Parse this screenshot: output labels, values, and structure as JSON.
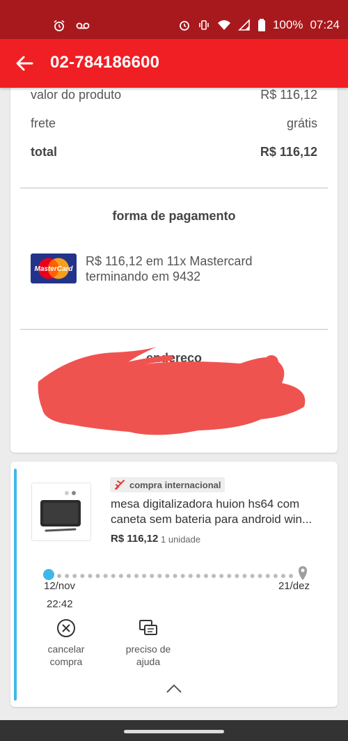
{
  "status_bar": {
    "battery": "100%",
    "time": "07:24"
  },
  "app_bar": {
    "title": "02-784186600"
  },
  "summary": {
    "product_value_label": "valor do produto",
    "product_value": "R$ 116,12",
    "shipping_label": "frete",
    "shipping_value": "grátis",
    "total_label": "total",
    "total_value": "R$ 116,12"
  },
  "payment": {
    "title": "forma de pagamento",
    "card_brand": "MasterCard",
    "line1": "R$ 116,12 em 11x Mastercard",
    "line2": "terminando em 9432"
  },
  "address": {
    "title": "endereço"
  },
  "order": {
    "badge": "compra internacional",
    "product_line1": "mesa digitalizadora huion hs64 com",
    "product_line2": "caneta sem bateria para android win...",
    "price": "R$ 116,12",
    "units": "1 unidade",
    "timeline": {
      "start_date": "12/nov",
      "end_date": "21/dez",
      "start_time": "22:42"
    },
    "actions": {
      "cancel_line1": "cancelar",
      "cancel_line2": "compra",
      "help_line1": "preciso de",
      "help_line2": "ajuda"
    }
  },
  "colors": {
    "status_bar": "#a8191d",
    "app_bar": "#ef1f24",
    "accent": "#3fb8e8",
    "redaction": "#ef5350"
  }
}
